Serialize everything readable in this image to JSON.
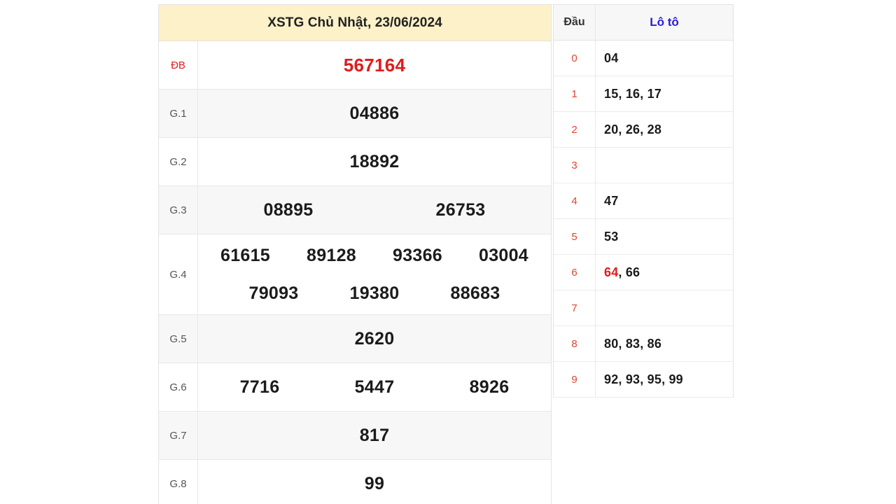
{
  "result_table": {
    "title": "XSTG Chủ Nhật, 23/06/2024",
    "rows": [
      {
        "label": "ĐB",
        "lines": [
          [
            "567164"
          ]
        ],
        "highlight": true
      },
      {
        "label": "G.1",
        "lines": [
          [
            "04886"
          ]
        ]
      },
      {
        "label": "G.2",
        "lines": [
          [
            "18892"
          ]
        ]
      },
      {
        "label": "G.3",
        "lines": [
          [
            "08895",
            "26753"
          ]
        ]
      },
      {
        "label": "G.4",
        "lines": [
          [
            "61615",
            "89128",
            "93366",
            "03004"
          ],
          [
            "79093",
            "19380",
            "88683"
          ]
        ]
      },
      {
        "label": "G.5",
        "lines": [
          [
            "2620"
          ]
        ]
      },
      {
        "label": "G.6",
        "lines": [
          [
            "7716",
            "5447",
            "8926"
          ]
        ]
      },
      {
        "label": "G.7",
        "lines": [
          [
            "817"
          ]
        ]
      },
      {
        "label": "G.8",
        "lines": [
          [
            "99"
          ]
        ]
      }
    ]
  },
  "loto_table": {
    "header": {
      "dau": "Đầu",
      "loto": "Lô tô"
    },
    "rows": [
      {
        "dau": "0",
        "values": "04",
        "highlight": ""
      },
      {
        "dau": "1",
        "values": "15, 16, 17",
        "highlight": ""
      },
      {
        "dau": "2",
        "values": "20, 26, 28",
        "highlight": ""
      },
      {
        "dau": "3",
        "values": "",
        "highlight": ""
      },
      {
        "dau": "4",
        "values": "47",
        "highlight": ""
      },
      {
        "dau": "5",
        "values": "53",
        "highlight": ""
      },
      {
        "dau": "6",
        "values": ", 66",
        "highlight": "64"
      },
      {
        "dau": "7",
        "values": "",
        "highlight": ""
      },
      {
        "dau": "8",
        "values": "80, 83, 86",
        "highlight": ""
      },
      {
        "dau": "9",
        "values": "92, 93, 95, 99",
        "highlight": ""
      }
    ]
  },
  "colors": {
    "header_bg": "#fcf1c8",
    "special_red": "#e01b1b",
    "loto_header_blue": "#2a1ae0",
    "dau_red": "#e0452f",
    "row_alt_bg": "#f7f7f7"
  }
}
